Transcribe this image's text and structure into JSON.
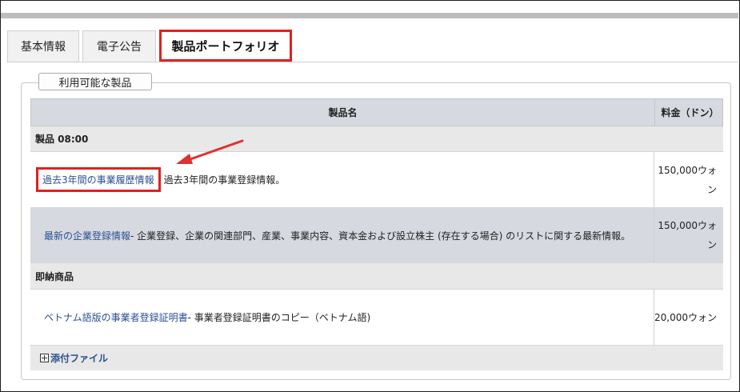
{
  "tabs": [
    {
      "label": "基本情報"
    },
    {
      "label": "電子公告"
    },
    {
      "label": "製品ポートフォリオ"
    }
  ],
  "panel": {
    "legend": "利用可能な製品",
    "columns": {
      "name": "製品名",
      "price": "料金（ドン）"
    },
    "groups": [
      {
        "title": "製品 08:00",
        "items": [
          {
            "link": "過去3年間の事業履歴情報",
            "desc": "過去3年間の事業登録情報。",
            "price": "150,000ウォン"
          },
          {
            "link": "最新の企業登録情報",
            "desc": " - 企業登録、企業の関連部門、産業、事業内容、資本金および設立株主 (存在する場合) のリストに関する最新情報。",
            "price": "150,000ウォン"
          }
        ]
      },
      {
        "title": "即納商品",
        "items": [
          {
            "link": "ベトナム語版の事業者登録証明書",
            "desc": " - 事業者登録証明書のコピー（ベトナム語)",
            "price": "20,000ウォン"
          }
        ]
      }
    ],
    "attachment": "添付ファイル"
  },
  "colors": {
    "highlight": "#e02020",
    "link": "#2b5190",
    "header_bg": "#d6d9e0"
  }
}
